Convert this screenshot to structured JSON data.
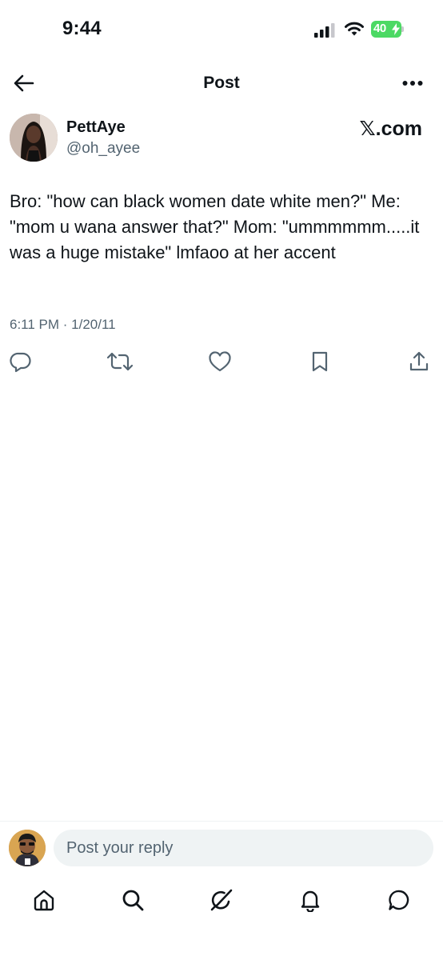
{
  "status": {
    "time": "9:44",
    "battery": "40",
    "icons": [
      "cellular-signal-icon",
      "wifi-icon",
      "battery-charging-icon"
    ]
  },
  "header": {
    "title": "Post",
    "icons": [
      "back-arrow-icon",
      "more-options-icon"
    ]
  },
  "author": {
    "name": "PettAye",
    "handle": "@oh_ayee"
  },
  "source": "𝕏.com",
  "tweet": {
    "text": "Bro: \"how can black women date white men?\" Me: \"mom u wana answer that?\" Mom: \"ummmmmm.....it was a huge mistake\" lmfaoo at her accent",
    "timestamp": "6:11 PM · 1/20/11"
  },
  "actions": [
    "reply-icon",
    "retweet-icon",
    "like-icon",
    "bookmark-icon",
    "share-icon"
  ],
  "reply": {
    "placeholder": "Post your reply"
  },
  "tabbar": [
    "home-icon",
    "search-icon",
    "grok-icon",
    "notifications-icon",
    "messages-icon"
  ],
  "colors": {
    "text": "#0f1419",
    "secondary": "#536471",
    "battery": "#4cd964",
    "input_bg": "#eff3f4"
  }
}
